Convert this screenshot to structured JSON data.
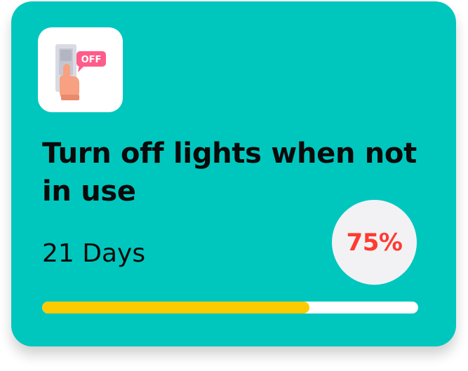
{
  "card": {
    "title": "Turn off lights when not in use",
    "duration": "21 Days",
    "progress_label": "75%",
    "progress_fraction": 0.71,
    "icon": "light-switch-off-icon",
    "icon_badge_text": "OFF"
  },
  "colors": {
    "card_background": "#00c7be",
    "progress_fill": "#fecb00",
    "progress_track": "#ffffff",
    "percent_text": "#ff3b30",
    "badge_background": "#f2f2f5",
    "icon_badge": "#ff5c8a"
  }
}
